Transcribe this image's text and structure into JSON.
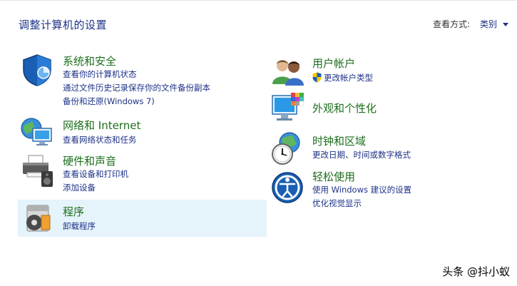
{
  "header": {
    "title": "调整计算机的设置",
    "view_by_label": "查看方式:",
    "view_by_value": "类别"
  },
  "categories": {
    "system": {
      "title": "系统和安全",
      "icon": "shield-icon",
      "links": [
        "查看你的计算机状态",
        "通过文件历史记录保存你的文件备份副本",
        "备份和还原(Windows 7)"
      ]
    },
    "network": {
      "title": "网络和 Internet",
      "icon": "network-globe-icon",
      "links": [
        "查看网络状态和任务"
      ]
    },
    "hardware": {
      "title": "硬件和声音",
      "icon": "printer-speaker-icon",
      "links": [
        "查看设备和打印机",
        "添加设备"
      ]
    },
    "programs": {
      "title": "程序",
      "icon": "programs-disc-icon",
      "links": [
        "卸载程序"
      ]
    },
    "user": {
      "title": "用户帐户",
      "icon": "users-icon",
      "links": [
        "更改帐户类型"
      ]
    },
    "appearance": {
      "title": "外观和个性化",
      "icon": "monitor-palette-icon",
      "links": []
    },
    "clock": {
      "title": "时钟和区域",
      "icon": "clock-globe-icon",
      "links": [
        "更改日期、时间或数字格式"
      ]
    },
    "ease": {
      "title": "轻松使用",
      "icon": "ease-of-access-icon",
      "links": [
        "使用 Windows 建议的设置",
        "优化视觉显示"
      ]
    }
  },
  "colors": {
    "title_green": "#1c6e1c",
    "link_blue": "#1e3287",
    "highlight": "#e5f3fb"
  },
  "watermark": "头条 @抖小蚁"
}
